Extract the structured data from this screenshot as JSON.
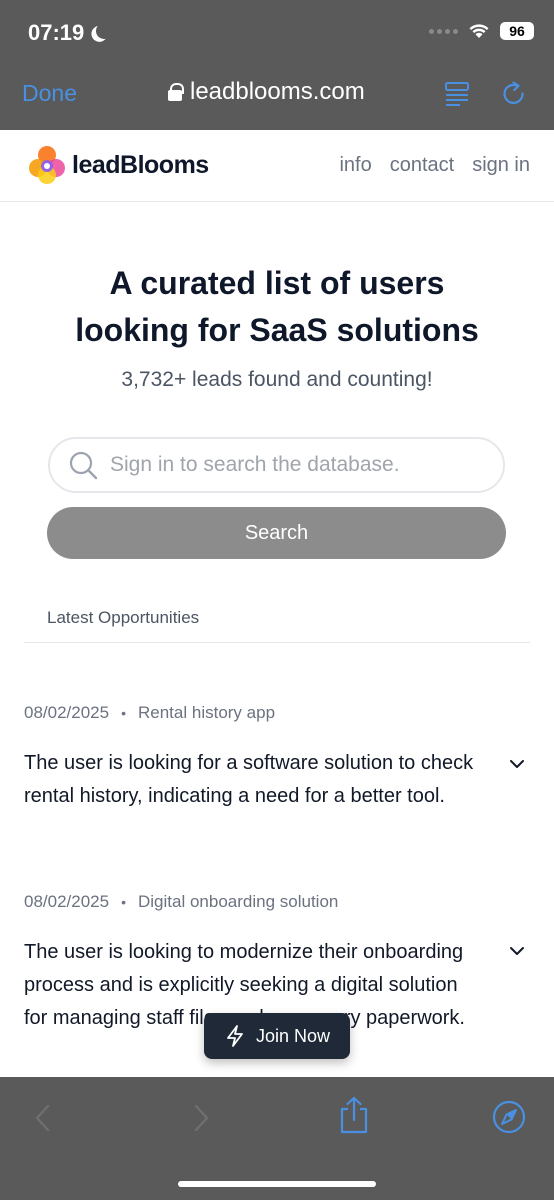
{
  "status_bar": {
    "time": "07:19",
    "battery": "96"
  },
  "browser": {
    "done_label": "Done",
    "url": "leadblooms.com"
  },
  "site": {
    "logo_text": "leadBlooms",
    "nav": [
      "info",
      "contact",
      "sign in"
    ]
  },
  "hero": {
    "title_line1": "A curated list of users",
    "title_line2": "looking for SaaS solutions",
    "subtitle": "3,732+ leads found and counting!"
  },
  "search": {
    "placeholder": "Sign in to search the database.",
    "button_label": "Search"
  },
  "section": {
    "title": "Latest Opportunities"
  },
  "leads": [
    {
      "date": "08/02/2025",
      "category": "Rental history app",
      "text": "The user is looking for a software solution to check rental history, indicating a need for a better tool."
    },
    {
      "date": "08/02/2025",
      "category": "Digital onboarding solution",
      "text": "The user is looking to modernize their onboarding process and is explicitly seeking a digital solution for managing staff files and necessary paperwork."
    }
  ],
  "cta": {
    "join_label": "Join Now"
  },
  "colors": {
    "accent": "#4a90e2",
    "chrome": "#5a5a5a",
    "dark": "#1f2937"
  }
}
